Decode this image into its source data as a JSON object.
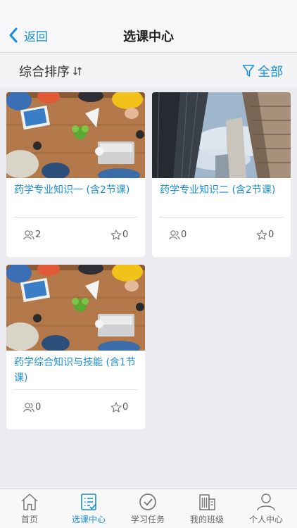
{
  "nav": {
    "back_label": "返回",
    "title": "选课中心"
  },
  "filter": {
    "sort_label": "综合排序",
    "filter_label": "全部"
  },
  "courses": [
    {
      "title": "药学专业知识一 (含2节课)",
      "students": "2",
      "favorites": "0",
      "image": "meeting-table-photo"
    },
    {
      "title": "药学专业知识二 (含2节课)",
      "students": "0",
      "favorites": "0",
      "image": "skyscrapers-photo"
    },
    {
      "title": "药学综合知识与技能 (含1节课)",
      "students": "0",
      "favorites": "0",
      "image": "meeting-table-photo"
    }
  ],
  "tabs": [
    {
      "label": "首页",
      "icon": "home-icon"
    },
    {
      "label": "选课中心",
      "icon": "course-list-icon",
      "active": true
    },
    {
      "label": "学习任务",
      "icon": "check-circle-icon"
    },
    {
      "label": "我的班级",
      "icon": "building-icon"
    },
    {
      "label": "个人中心",
      "icon": "person-icon"
    }
  ],
  "colors": {
    "accent": "#1a8fd6",
    "background": "#ebebf0"
  }
}
